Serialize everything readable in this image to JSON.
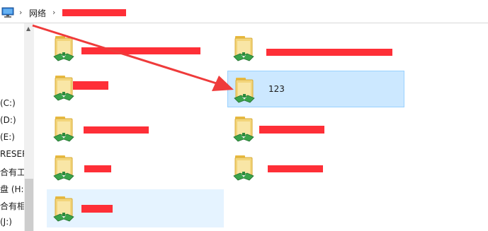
{
  "address_bar": {
    "crumbs": [
      {
        "label": "网络"
      }
    ],
    "current_location_redacted": true
  },
  "navigation_pane": {
    "items": [
      {
        "label": "(C:)"
      },
      {
        "label": "(D:)"
      },
      {
        "label": "(E:)"
      },
      {
        "label": "RESER"
      },
      {
        "label": "合有工('"
      },
      {
        "label": "盘 (H:)"
      },
      {
        "label": "合有相,"
      },
      {
        "label": "(J:)"
      }
    ]
  },
  "files": {
    "items": [
      {
        "label": "",
        "redacted": true,
        "state": "normal"
      },
      {
        "label": "",
        "redacted": true,
        "state": "normal"
      },
      {
        "label": "",
        "redacted": true,
        "state": "normal"
      },
      {
        "label": "123",
        "redacted": false,
        "state": "selected"
      },
      {
        "label": "",
        "redacted": true,
        "state": "normal"
      },
      {
        "label": "",
        "redacted": true,
        "state": "normal"
      },
      {
        "label": "",
        "redacted": true,
        "state": "normal"
      },
      {
        "label": "",
        "redacted": true,
        "state": "normal"
      },
      {
        "label": "",
        "redacted": true,
        "state": "hover"
      }
    ]
  },
  "colors": {
    "redaction": "#fe2f37",
    "selection_bg": "#cce8ff",
    "selection_border": "#99d1ff",
    "hover_bg": "#e5f3ff",
    "annotation_arrow": "#ef3b3b"
  },
  "icons": {
    "address_bar": "computer-icon",
    "tile": "network-shared-folder-icon"
  }
}
